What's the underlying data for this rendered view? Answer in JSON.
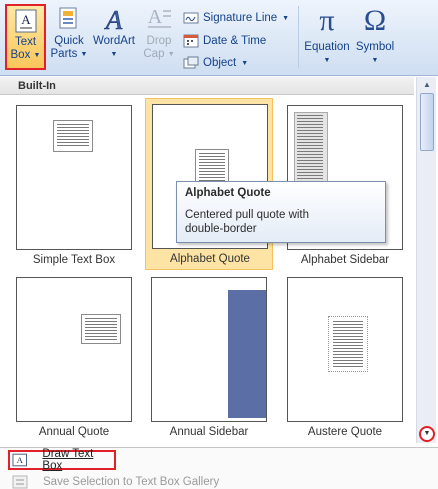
{
  "ribbon": {
    "text_box": {
      "line1": "Text",
      "line2": "Box",
      "icon": "text-box-icon"
    },
    "quick_parts": {
      "line1": "Quick",
      "line2": "Parts",
      "icon": "quick-parts-icon"
    },
    "wordart": {
      "line1": "WordArt",
      "icon": "wordart-icon"
    },
    "drop_cap": {
      "line1": "Drop",
      "line2": "Cap",
      "icon": "drop-cap-icon",
      "disabled": true
    },
    "signature_line": {
      "label": "Signature Line",
      "icon": "signature-icon"
    },
    "date_time": {
      "label": "Date & Time",
      "icon": "calendar-icon"
    },
    "object": {
      "label": "Object",
      "icon": "object-icon"
    },
    "equation": {
      "label": "Equation",
      "symbol": "π",
      "icon": "pi-icon"
    },
    "symbol": {
      "label": "Symbol",
      "symbol": "Ω",
      "icon": "omega-icon"
    }
  },
  "gallery": {
    "section_title": "Built-In",
    "items": [
      {
        "label": "Simple Text Box"
      },
      {
        "label": "Alphabet Quote",
        "selected": true
      },
      {
        "label": "Alphabet Sidebar"
      },
      {
        "label": "Annual Quote"
      },
      {
        "label": "Annual Sidebar"
      },
      {
        "label": "Austere Quote"
      }
    ],
    "tooltip": {
      "title": "Alphabet Quote",
      "body_line1": "Centered pull quote with",
      "body_line2": "double-border"
    }
  },
  "menu": {
    "draw_text_box": "Draw Text Box",
    "save_selection": "Save Selection to Text Box Gallery"
  },
  "colors": {
    "accent": "#15428b",
    "highlight_outline": "#e0202a",
    "selected_tile": "#fde4a5",
    "sidebar_blue": "#5c6ea6"
  }
}
